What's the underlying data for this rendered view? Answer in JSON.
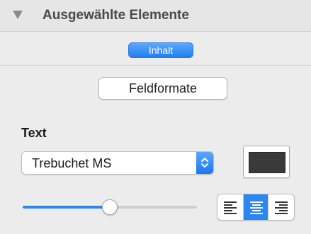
{
  "header": {
    "title": "Ausgewählte Elemente"
  },
  "tab": {
    "label": "Inhalt"
  },
  "buttons": {
    "feldformate": "Feldformate"
  },
  "text_section": {
    "title": "Text",
    "font": {
      "value": "Trebuchet MS"
    },
    "color": "#3a3a3a",
    "size_slider": {
      "value_fraction": 0.5
    },
    "alignment": {
      "options": [
        "left",
        "center",
        "right"
      ],
      "selected": "center"
    }
  },
  "colors": {
    "accent": "#2b85f3"
  }
}
